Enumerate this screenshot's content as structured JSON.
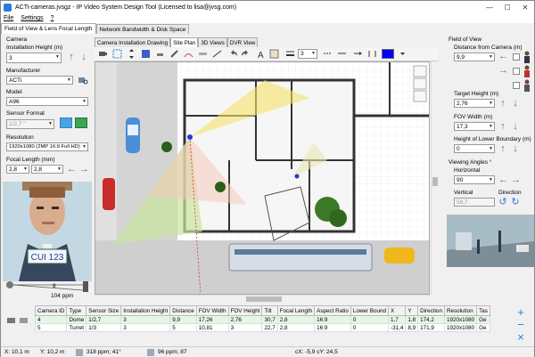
{
  "window": {
    "title": "ACTi-cameras.jvsgz - IP Video System Design Tool (Licensed to lisa@jvsg.com)",
    "minimize": "—",
    "maximize": "☐",
    "close": "✕"
  },
  "menu": {
    "file": "File",
    "settings": "Settings",
    "help": "?"
  },
  "main_tabs": [
    "Field of View & Lens Focal Length",
    "Network Bandwidth & Disk Space"
  ],
  "left": {
    "camera_section": "Camera",
    "install_height_label": "Installation Height (m)",
    "install_height_value": "3",
    "manufacturer_label": "Manufacturer",
    "manufacturer_value": "ACTi",
    "model_label": "Model",
    "model_value": "A96",
    "sensor_label": "Sensor Format",
    "sensor_value": "1/2.7 \"",
    "resolution_label": "Resolution",
    "resolution_value": "1920x1080 (2MP 16:9 Full HD)",
    "focal_label": "Focal Length (mm)",
    "focal_min": "2,8",
    "focal_max": "2,8",
    "plate_text": "CUI 123",
    "ppm_distance": "8",
    "ppm_value": "104 ppm"
  },
  "center_tabs": [
    "Camera Installation Drawing",
    "Site Plan",
    "3D Views",
    "DVR View"
  ],
  "toolbar": {
    "line_width": "3",
    "color_hex": "#0000ff"
  },
  "right": {
    "fov_section": "Field of View",
    "distance_label": "Distance from Camera (m)",
    "distance_value": "9,9",
    "target_height_label": "Target Height (m)",
    "target_height_value": "2,76",
    "fov_width_label": "FOV Width (m)",
    "fov_width_value": "17,3",
    "lower_boundary_label": "Height of Lower Boundary (m)",
    "lower_boundary_value": "0",
    "viewing_angles_label": "Viewing Angles °",
    "horizontal_label": "Horizontal",
    "horizontal_value": "90",
    "vertical_label": "Vertical",
    "vertical_value": "58,7",
    "direction_label": "Direction"
  },
  "table": {
    "headers": [
      "Camera ID",
      "Type",
      "Sensor Size",
      "Installation Height",
      "Distance",
      "FOV Width",
      "FOV Height",
      "Tilt",
      "Focal Length",
      "Aspect Ratio",
      "Lower Bound",
      "X",
      "Y",
      "Direction",
      "Resolution",
      "Tas"
    ],
    "rows": [
      [
        "4",
        "Dome",
        "1/2,7",
        "3",
        "9,9",
        "17,26",
        "2,76",
        "30,7",
        "2,8",
        "16:9",
        "0",
        "1,7",
        "1,8",
        "174,2",
        "1920x1080",
        "Ge"
      ],
      [
        "5",
        "Turret",
        "1/3",
        "3",
        "5",
        "10,81",
        "3",
        "22,7",
        "2,8",
        "16:9",
        "0",
        "-31,4",
        "8,9",
        "171,9",
        "1920x1080",
        "Ge"
      ]
    ]
  },
  "status": {
    "x": "X: 10,1 m",
    "y": "Y: 10,2 m",
    "ppm1": "318 ppm; 41°",
    "ppm2": "96 ppm; 87",
    "coords": "cX: -5,9 cY: 24,5"
  },
  "colors": {
    "accent_blue": "#2a7fd4",
    "fov_yellow": "#f6e36b",
    "fov_green": "#c9e5a0",
    "plan_grid": "#d8d8d8",
    "wall": "#333333"
  }
}
